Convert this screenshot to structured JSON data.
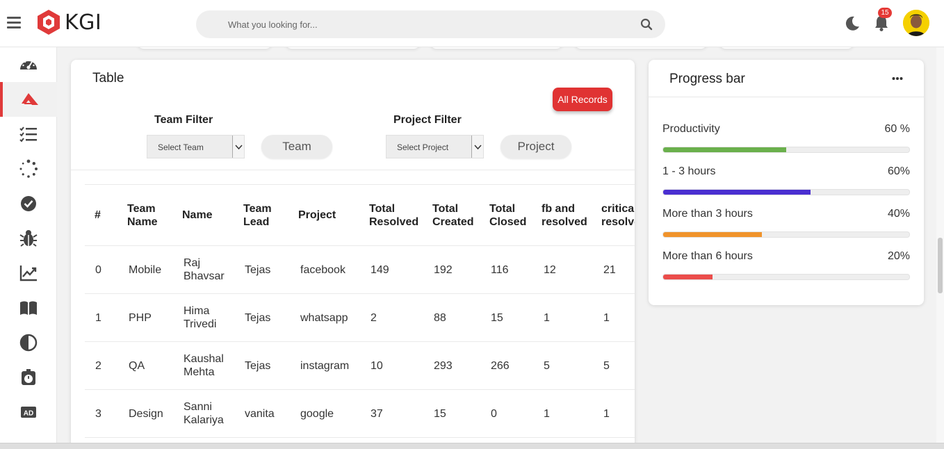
{
  "header": {
    "logo_text": "KGI",
    "search_placeholder": "What you looking for...",
    "notification_count": "15"
  },
  "sidebar": {
    "items": [
      {
        "icon": "dashboard-gauge-icon"
      },
      {
        "icon": "kgi-logo-icon",
        "active": true
      },
      {
        "icon": "checklist-icon"
      },
      {
        "icon": "loading-spinner-icon"
      },
      {
        "icon": "check-circle-icon"
      },
      {
        "icon": "bug-icon"
      },
      {
        "icon": "trending-chart-icon"
      },
      {
        "icon": "book-icon"
      },
      {
        "icon": "contrast-icon"
      },
      {
        "icon": "timer-icon"
      },
      {
        "icon": "ad-icon"
      }
    ]
  },
  "table_card": {
    "title": "Table",
    "all_records_label": "All Records",
    "team_filter": {
      "label": "Team Filter",
      "select_value": "Select Team",
      "button_label": "Team"
    },
    "project_filter": {
      "label": "Project Filter",
      "select_value": "Select Project",
      "button_label": "Project"
    },
    "columns": [
      "#",
      "Team Name",
      "Name",
      "Team Lead",
      "Project",
      "Total Resolved",
      "Total Created",
      "Total Closed",
      "fb and resolved",
      "critical resolved"
    ],
    "rows": [
      [
        "0",
        "Mobile",
        "Raj Bhavsar",
        "Tejas",
        "facebook",
        "149",
        "192",
        "116",
        "12",
        "21"
      ],
      [
        "1",
        "PHP",
        "Hima Trivedi",
        "Tejas",
        "whatsapp",
        "2",
        "88",
        "15",
        "1",
        "1"
      ],
      [
        "2",
        "QA",
        "Kaushal Mehta",
        "Tejas",
        "instagram",
        "10",
        "293",
        "266",
        "5",
        "5"
      ],
      [
        "3",
        "Design",
        "Sanni Kalariya",
        "vanita",
        "google",
        "37",
        "15",
        "0",
        "1",
        "1"
      ]
    ]
  },
  "progress_card": {
    "title": "Progress bar",
    "items": [
      {
        "label": "Productivity",
        "value_text": "60 %",
        "percent": 50,
        "color": "#6ab04c"
      },
      {
        "label": "1 - 3 hours",
        "value_text": "60%",
        "percent": 60,
        "color": "#4a2fd1"
      },
      {
        "label": "More than 3 hours",
        "value_text": "40%",
        "percent": 40,
        "color": "#f0932b"
      },
      {
        "label": "More than 6 hours",
        "value_text": "20%",
        "percent": 20,
        "color": "#eb4d4b"
      }
    ]
  }
}
